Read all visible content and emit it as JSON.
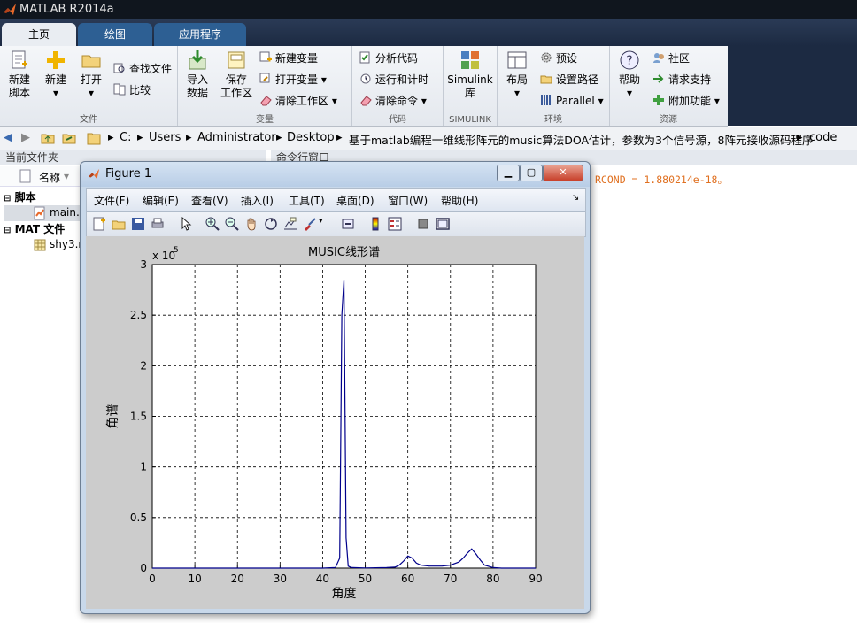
{
  "app": {
    "title": "MATLAB R2014a"
  },
  "tabs": [
    {
      "label": "主页"
    },
    {
      "label": "绘图"
    },
    {
      "label": "应用程序"
    }
  ],
  "ribbon": {
    "file_group": {
      "label": "文件",
      "new_script": "新建\n脚本",
      "new": "新建",
      "open": "打开",
      "find_files": "查找文件",
      "compare": "比较"
    },
    "var_group": {
      "label": "变量",
      "import": "导入\n数据",
      "save_ws": "保存\n工作区",
      "new_var": "新建变量",
      "open_var": "打开变量",
      "clear_ws": "清除工作区"
    },
    "code_group": {
      "label": "代码",
      "analyze": "分析代码",
      "run_time": "运行和计时",
      "clear_cmd": "清除命令"
    },
    "simulink_group": {
      "label": "SIMULINK",
      "lib": "Simulink\n库"
    },
    "env_group": {
      "label": "环境",
      "layout": "布局",
      "prefs": "预设",
      "set_path": "设置路径",
      "parallel": "Parallel"
    },
    "res_group": {
      "label": "资源",
      "help": "帮助",
      "community": "社区",
      "support": "请求支持",
      "addons": "附加功能"
    }
  },
  "address": {
    "parts": [
      "C:",
      "Users",
      "Administrator",
      "Desktop",
      "基于matlab编程一维线形阵元的music算法DOA估计，参数为3个信号源，8阵元接收源码程序",
      "code"
    ]
  },
  "left_panel": {
    "header": "当前文件夹",
    "col_name": "名称",
    "groups": [
      {
        "label": "脚本",
        "items": [
          {
            "name": "main.m"
          }
        ]
      },
      {
        "label": "MAT 文件",
        "items": [
          {
            "name": "shy3.mat"
          }
        ]
      }
    ]
  },
  "command": {
    "header": "命令行窗口",
    "output": "RCOND =  1.880214e-18。"
  },
  "figure": {
    "title": "Figure 1",
    "menu": [
      "文件(F)",
      "编辑(E)",
      "查看(V)",
      "插入(I)",
      "工具(T)",
      "桌面(D)",
      "窗口(W)",
      "帮助(H)"
    ],
    "menu_arrow": "↘"
  },
  "chart_data": {
    "type": "line",
    "title": "MUSIC线形谱",
    "xlabel": "角度",
    "ylabel": "角谱",
    "y_multiplier": "x 10",
    "y_multiplier_exp": "5",
    "xlim": [
      0,
      90
    ],
    "ylim": [
      0,
      3
    ],
    "xticks": [
      0,
      10,
      20,
      30,
      40,
      50,
      60,
      70,
      80,
      90
    ],
    "yticks": [
      0,
      0.5,
      1,
      1.5,
      2,
      2.5,
      3
    ],
    "grid": true,
    "line_color": "#00008b",
    "x": [
      0,
      10,
      20,
      30,
      40,
      43,
      44,
      44.5,
      45,
      45.5,
      46,
      46.5,
      47,
      50,
      55,
      57,
      58,
      59,
      60,
      61,
      62,
      63,
      65,
      68,
      70,
      72,
      73,
      74,
      75,
      76,
      77,
      78,
      80,
      82,
      85,
      90
    ],
    "y": [
      0,
      0,
      0,
      0,
      0,
      0.005,
      0.1,
      2.5,
      2.85,
      0.3,
      0.02,
      0.01,
      0.005,
      0.002,
      0.005,
      0.01,
      0.03,
      0.07,
      0.12,
      0.1,
      0.05,
      0.03,
      0.02,
      0.02,
      0.03,
      0.06,
      0.1,
      0.15,
      0.19,
      0.14,
      0.08,
      0.03,
      0.005,
      0,
      0,
      0
    ]
  }
}
